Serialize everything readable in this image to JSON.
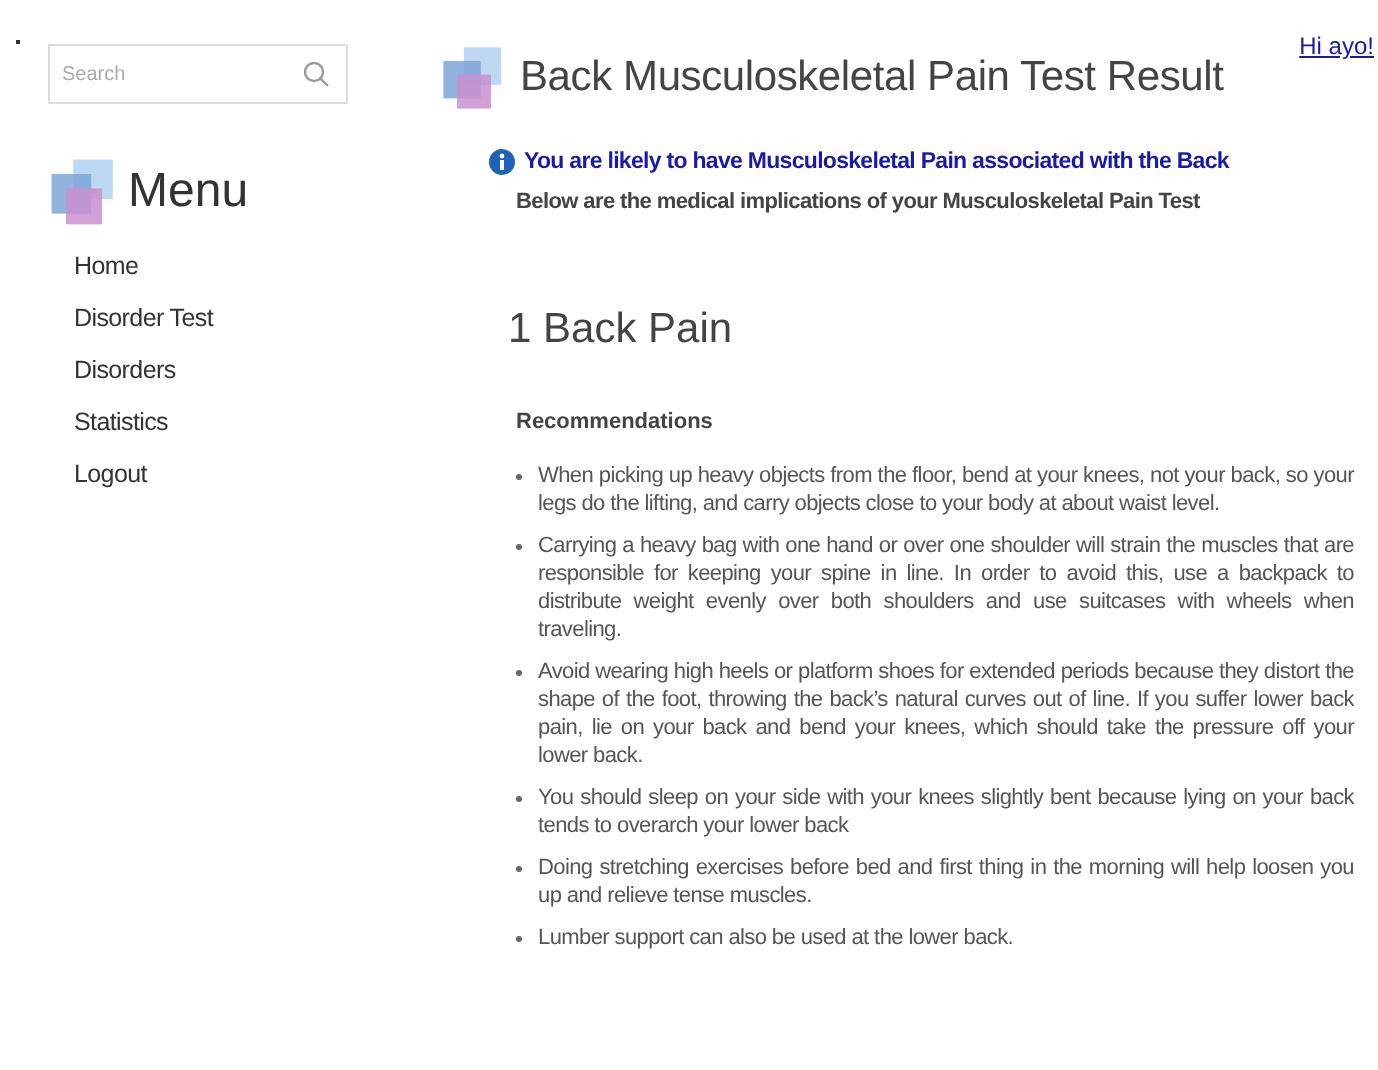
{
  "search": {
    "placeholder": "Search"
  },
  "menu": {
    "title": "Menu",
    "items": [
      {
        "label": "Home"
      },
      {
        "label": "Disorder Test"
      },
      {
        "label": "Disorders"
      },
      {
        "label": "Statistics"
      },
      {
        "label": "Logout"
      }
    ]
  },
  "user_link": "Hi ayo!",
  "page_title": "Back Musculoskeletal Pain Test Result",
  "result_notice": "You are likely to have Musculoskeletal Pain associated with the Back",
  "subtitle": "Below are the medical implications of your Musculoskeletal Pain Test",
  "section": {
    "title": "1 Back Pain",
    "heading": "Recommendations",
    "items": [
      "When picking up heavy objects from the floor, bend at your knees, not your back, so your legs do the lifting, and carry objects close to your body at about waist level.",
      "Carrying a heavy bag with one hand or over one shoulder will strain the muscles that are responsible for keeping your spine in line. In order to avoid this, use a backpack to distribute weight evenly over both shoulders and use suitcases with wheels when traveling.",
      "Avoid wearing high heels or platform shoes for extended periods because they distort the shape of the foot, throwing the back’s natural curves out of line. If you suffer lower back pain, lie on your back and bend your knees, which should take the pressure off your lower back.",
      "You should sleep on your side with your knees slightly bent because lying on your back tends to overarch your lower back",
      "Doing stretching exercises before bed and first thing in the morning will help loosen you up and relieve tense muscles.",
      "Lumber support can also be used at the lower back."
    ]
  }
}
